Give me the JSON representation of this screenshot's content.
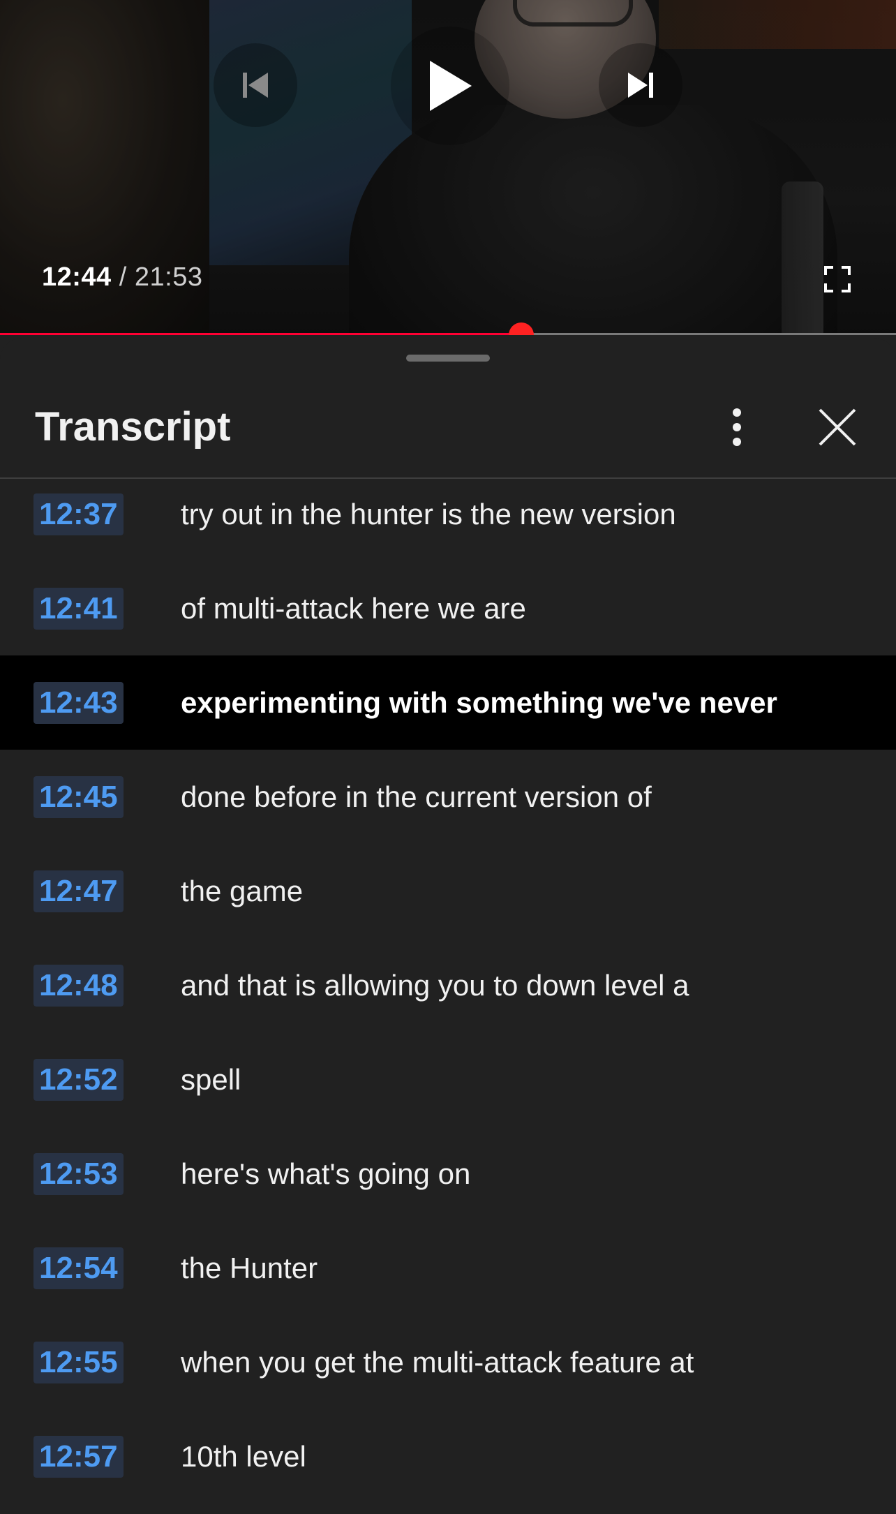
{
  "player": {
    "current_time": "12:44",
    "separator": "/",
    "duration": "21:53",
    "progress_fraction": 0.582,
    "accent_color": "#ff0033",
    "controls": {
      "previous_icon": "skip-previous-icon",
      "play_icon": "play-icon",
      "next_icon": "skip-next-icon",
      "fullscreen_icon": "fullscreen-icon"
    }
  },
  "transcript": {
    "title": "Transcript",
    "menu_icon": "more-vertical-icon",
    "close_icon": "close-icon",
    "timestamp_color": "#4e9bf2",
    "rows": [
      {
        "time": "12:37",
        "text": "try out in the hunter is the new version",
        "active": false
      },
      {
        "time": "12:41",
        "text": "of multi-attack here we are",
        "active": false
      },
      {
        "time": "12:43",
        "text": "experimenting with something we've never",
        "active": true
      },
      {
        "time": "12:45",
        "text": "done before in the current version of",
        "active": false
      },
      {
        "time": "12:47",
        "text": "the game",
        "active": false
      },
      {
        "time": "12:48",
        "text": "and that is allowing you to down level a",
        "active": false
      },
      {
        "time": "12:52",
        "text": "spell",
        "active": false
      },
      {
        "time": "12:53",
        "text": "here's what's going on",
        "active": false
      },
      {
        "time": "12:54",
        "text": "the Hunter",
        "active": false
      },
      {
        "time": "12:55",
        "text": "when you get the multi-attack feature at",
        "active": false
      },
      {
        "time": "12:57",
        "text": "10th level",
        "active": false
      }
    ]
  }
}
